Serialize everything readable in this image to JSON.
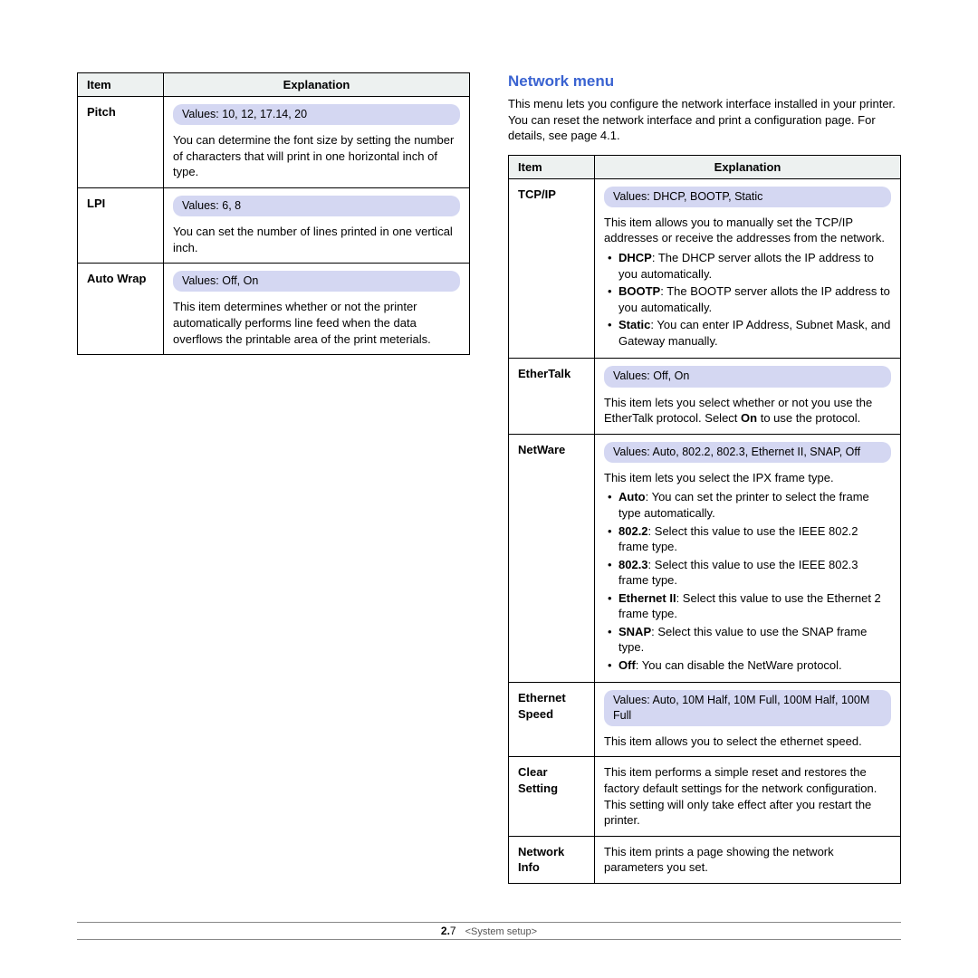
{
  "left_table": {
    "headers": {
      "item": "Item",
      "explanation": "Explanation"
    },
    "rows": [
      {
        "item": "Pitch",
        "values": "Values: 10, 12, 17.14, 20",
        "desc": "You can determine the font size by setting the number of characters that will print in one horizontal inch of type."
      },
      {
        "item": "LPI",
        "values": "Values: 6, 8",
        "desc": "You can set the number of lines printed in one vertical inch."
      },
      {
        "item": "Auto Wrap",
        "values": "Values: Off, On",
        "desc": "This item determines whether or not the printer automatically performs line feed when the data overflows the printable area of the print meterials."
      }
    ]
  },
  "right": {
    "title": "Network menu",
    "intro": "This menu lets you configure the network interface installed in your printer. You can reset the network interface and print a configuration page. For details, see page 4.1.",
    "headers": {
      "item": "Item",
      "explanation": "Explanation"
    },
    "tcpip": {
      "item": "TCP/IP",
      "values": "Values: DHCP, BOOTP, Static",
      "desc": "This item allows you to manually set the TCP/IP addresses or receive the addresses from the network.",
      "b1k": "DHCP",
      "b1t": ": The DHCP server allots the IP address to you automatically.",
      "b2k": "BOOTP",
      "b2t": ": The BOOTP server allots the IP address to you automatically.",
      "b3k": "Static",
      "b3t": ": You can enter IP Address, Subnet Mask, and Gateway manually."
    },
    "ethertalk": {
      "item": "EtherTalk",
      "values": "Values: Off, On",
      "desc_pre": "This item lets you select whether or not you use the EtherTalk protocol. Select ",
      "desc_bold": "On",
      "desc_post": " to use the protocol."
    },
    "netware": {
      "item": "NetWare",
      "values": "Values: Auto, 802.2, 802.3, Ethernet II, SNAP, Off",
      "desc": "This item lets you select the IPX frame type.",
      "b1k": "Auto",
      "b1t": ": You can set the printer to select the frame type automatically.",
      "b2k": "802.2",
      "b2t": ": Select this value to use the IEEE 802.2 frame type.",
      "b3k": "802.3",
      "b3t": ": Select this value to use the IEEE 802.3 frame type.",
      "b4k": "Ethernet II",
      "b4t": ": Select this value to use the Ethernet 2 frame type.",
      "b5k": "SNAP",
      "b5t": ": Select this value to use the SNAP frame type.",
      "b6k": "Off",
      "b6t": ": You can disable the NetWare protocol."
    },
    "ethspeed": {
      "item": "Ethernet Speed",
      "values": "Values: Auto, 10M Half, 10M Full, 100M Half, 100M Full",
      "desc": "This item allows you to select the ethernet speed."
    },
    "clear": {
      "item": "Clear Setting",
      "desc": "This item performs a simple reset and restores the factory default settings for the network configuration. This setting will only take effect after you restart the printer."
    },
    "netinfo": {
      "item": "Network Info",
      "desc": "This item prints a page showing the network parameters you set."
    }
  },
  "footer": {
    "bold": "2.",
    "num": "7",
    "label": "<System setup>"
  }
}
